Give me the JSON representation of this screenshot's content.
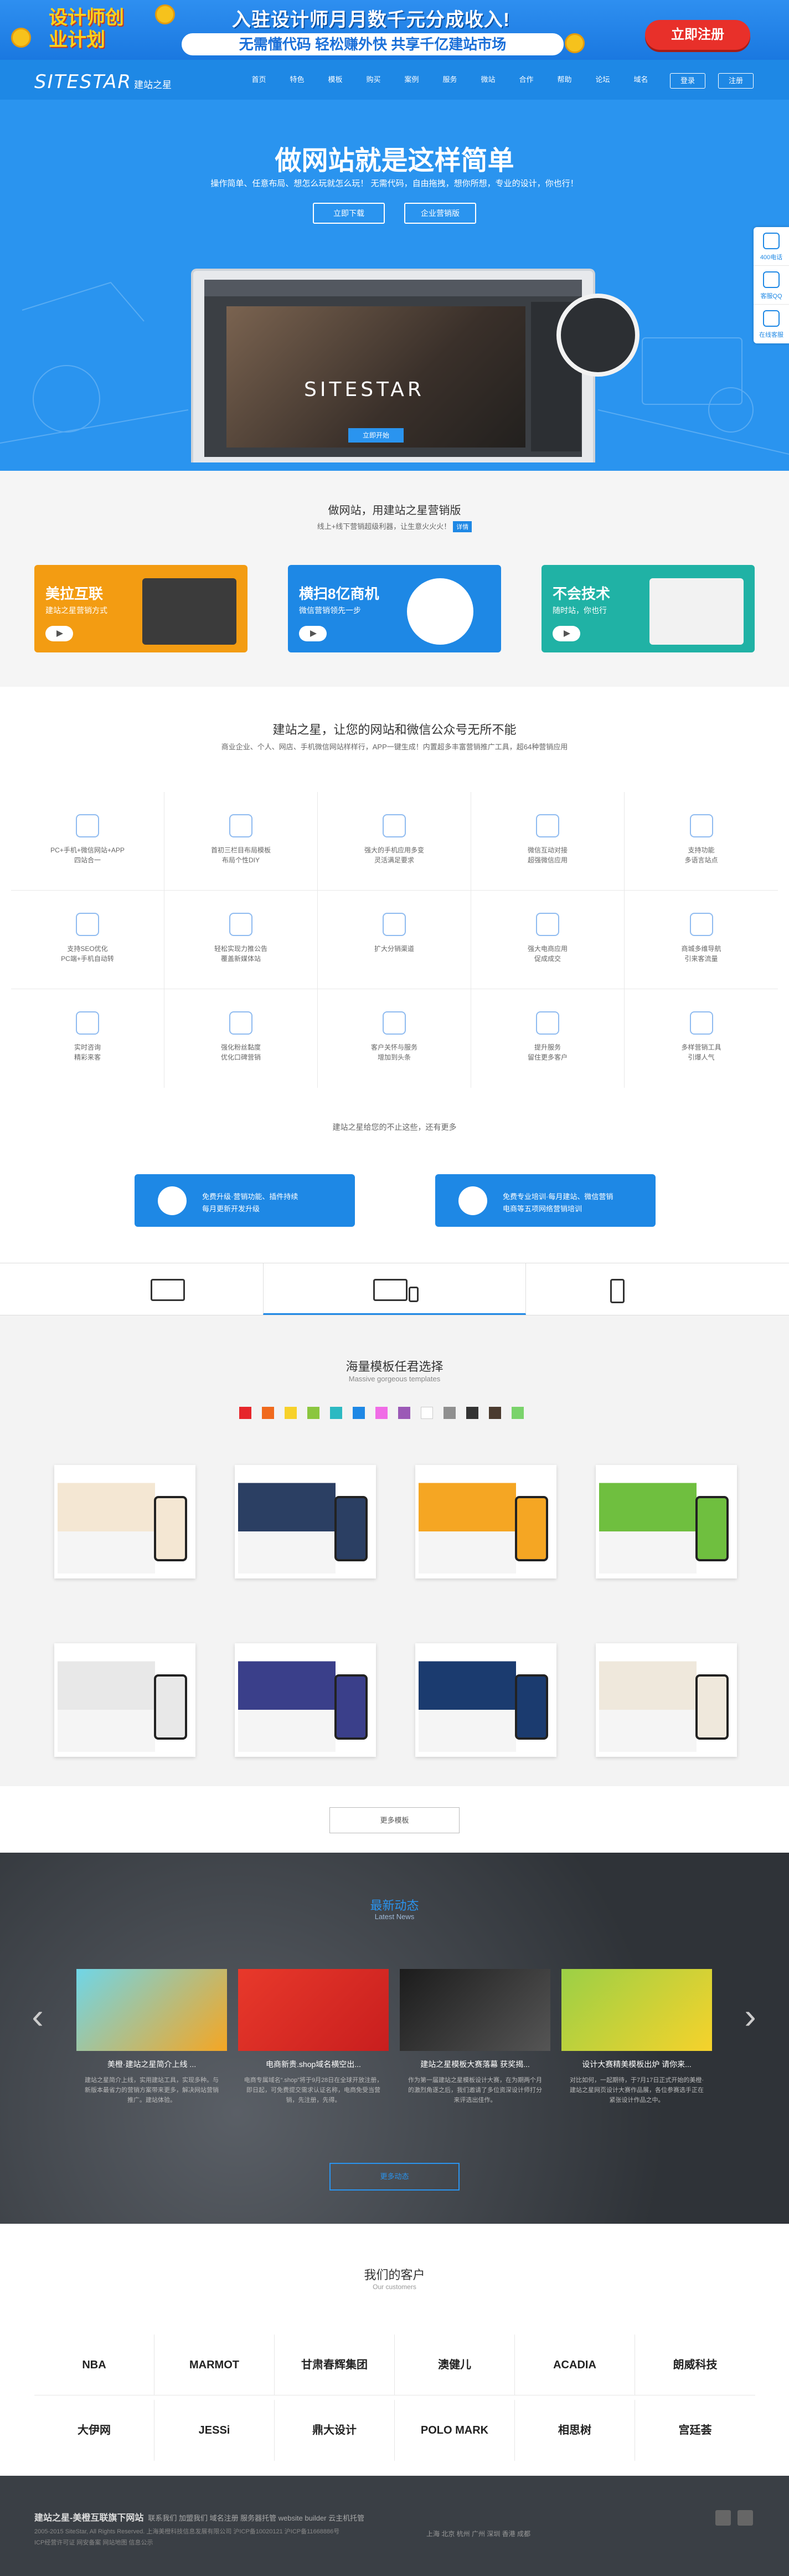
{
  "banner": {
    "logo": "设计师创业计划",
    "headline": "入驻设计师月月数千元分成收入!",
    "subline": "无需懂代码  轻松赚外快  共享千亿建站市场",
    "cta": "立即注册"
  },
  "nav": {
    "logo": "SITESTAR",
    "logo_cn": "建站之星",
    "items": [
      "首页",
      "特色",
      "模板",
      "购买",
      "案例",
      "服务",
      "微站",
      "合作",
      "帮助",
      "论坛",
      "域名"
    ],
    "login": "登录",
    "register": "注册"
  },
  "hero": {
    "title": "做网站就是这样简单",
    "subtitle": "操作简单、任意布局、想怎么玩就怎么玩！ 无需代码，自由拖拽，想你所想，专业的设计，你也行！",
    "btn_create": "立即下载",
    "btn_enterprise": "企业营销版",
    "screen_brand": "SITESTAR",
    "screen_btn": "立即开始"
  },
  "float": [
    {
      "label": "400电话"
    },
    {
      "label": "客服QQ"
    },
    {
      "label": "在线客服"
    }
  ],
  "marketing": {
    "title": "做网站，用建站之星营销版",
    "subtitle": "线上+线下营销超级利器，让生意火火火！",
    "tag": "详情",
    "cards": [
      {
        "title": "美拉互联",
        "sub": "建站之星营销方式",
        "color": "#f39c12"
      },
      {
        "title": "横扫8亿商机",
        "sub": "微信营销领先一步",
        "color": "#1e88e5"
      },
      {
        "title": "不会技术",
        "sub": "随时站，你也行",
        "color": "#20b2a5"
      }
    ]
  },
  "features": {
    "title": "建站之星，让您的网站和微信公众号无所不能",
    "subtitle": "商业企业、个人、网店、手机微信网站样样行，APP一键生成！内置超多丰富营销推广工具，超64种营销应用",
    "cells": [
      {
        "l1": "PC+手机+微信网站+APP",
        "l2": "四站合一"
      },
      {
        "l1": "首初三栏目布局模板",
        "l2": "布局个性DIY"
      },
      {
        "l1": "强大的手机应用多变",
        "l2": "灵活满足要求"
      },
      {
        "l1": "微信互动对接",
        "l2": "超强微信应用"
      },
      {
        "l1": "支持功能",
        "l2": "多语言站点"
      },
      {
        "l1": "支持SEO优化",
        "l2": "PC端+手机自动转"
      },
      {
        "l1": "轻松实现力推公告",
        "l2": "覆盖新媒体站"
      },
      {
        "l1": "扩大分销渠道",
        "l2": ""
      },
      {
        "l1": "强大电商应用",
        "l2": "促成成交"
      },
      {
        "l1": "商城多维导航",
        "l2": "引来客流量"
      },
      {
        "l1": "实时咨询",
        "l2": "精彩来客"
      },
      {
        "l1": "强化粉丝黏度",
        "l2": "优化口碑营销"
      },
      {
        "l1": "客户关怀与服务",
        "l2": "增加到头条"
      },
      {
        "l1": "提升服务",
        "l2": "留住更多客户"
      },
      {
        "l1": "多样营销工具",
        "l2": "引爆人气"
      }
    ],
    "footer": "建站之星给您的不止这些，还有更多",
    "btn_left_l1": "免费升级·营销功能、插件持续",
    "btn_left_l2": "每月更新开发升级",
    "btn_right_l1": "免费专业培训·每月建站、微信营销",
    "btn_right_l2": "电商等五项网络营销培训"
  },
  "templates": {
    "title": "海量模板任君选择",
    "subtitle": "Massive gorgeous templates",
    "swatches": [
      "#e6262b",
      "#f06a1d",
      "#f7d12a",
      "#8bc63f",
      "#2cb9c2",
      "#1e88e5",
      "#f06ce6",
      "#9b59b6",
      "#ffffff",
      "#8f8f8f",
      "#333333",
      "#4b3b2f",
      "#7ad36b"
    ],
    "more": "更多模板"
  },
  "news": {
    "title": "最新动态",
    "subtitle": "Latest News",
    "items": [
      {
        "title": "美橙·建站之星简介上线 ...",
        "desc": "建站之星简介上线，实用建站工具，实现多种。与新版本最省力的营销方案带来更多，解决网站营销推广。建站体验。"
      },
      {
        "title": "电商新贵.shop域名横空出...",
        "desc": "电商专属域名“.shop”将于9月28日在全球开放注册，即日起，可免费提交需求认证名称，电商免受当营销，先注册，先得。"
      },
      {
        "title": "建站之星模板大赛落幕 获奖揭...",
        "desc": "作为第一届建站之星模板设计大赛，在为期两个月的激烈角逐之后，我们邀请了多位资深设计师打分来评选出佳作。"
      },
      {
        "title": "设计大赛精美模板出炉 请你来...",
        "desc": "对比如何，一起期待，于7月17日正式开始的美橙·建站之星网页设计大赛作品展，各位参赛选手正在紧张设计作品之中。"
      }
    ],
    "more": "更多动态"
  },
  "customers": {
    "title": "我们的客户",
    "subtitle": "Our customers",
    "logos": [
      "NBA",
      "MARMOT",
      "甘肃春辉集团",
      "澳健儿",
      "ACADIA",
      "朗威科技",
      "大伊网",
      "JESSi",
      "鼎大设计",
      "POLO MARK",
      "相思树",
      "宫廷荟"
    ]
  },
  "footer": {
    "brand": "建站之星-美橙互联旗下网站",
    "links": "联系我们  加盟我们  域名注册  服务器托管  website builder  云主机托管",
    "copyright": "2005-2015 SiteStar, All Rights Reserved.    上海美橙科技信息发展有限公司    沪ICP备10020121    沪ICP备11668886号",
    "misc": "ICP经营许可证  网安备案  网站地图  信息公示",
    "cities": "上海 北京 杭州 广州 深圳 香港 成都"
  }
}
